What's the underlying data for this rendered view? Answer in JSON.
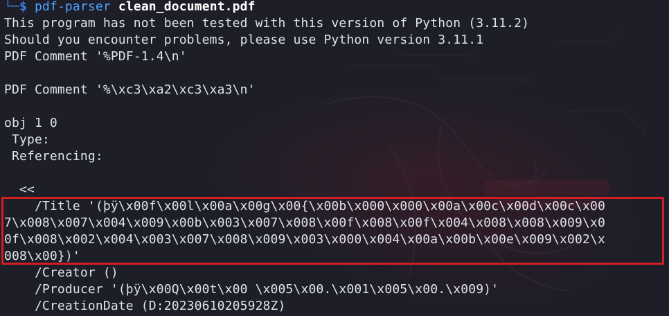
{
  "prompt": {
    "branch": "└─",
    "dollar": "$",
    "command": "pdf-parser",
    "argument": "clean_document.pdf"
  },
  "output": {
    "line1": "This program has not been tested with this version of Python (3.11.2)",
    "line2": "Should you encounter problems, please use Python version 3.11.1",
    "line3": "PDF Comment '%PDF-1.4\\n'",
    "line4": "PDF Comment '%\\xc3\\xa2\\xc3\\xa3\\n'",
    "line5": "obj 1 0",
    "line6": " Type: ",
    "line7": " Referencing: ",
    "line8": "  <<",
    "title_line1": "    /Title '(þÿ\\x00f\\x00l\\x00a\\x00g\\x00{\\x00b\\x000\\x000\\x00a\\x00c\\x00d\\x00c\\x00",
    "title_line2": "7\\x008\\x007\\x004\\x009\\x00b\\x003\\x007\\x008\\x00f\\x008\\x00f\\x004\\x008\\x008\\x009\\x0",
    "title_line3": "0f\\x008\\x002\\x004\\x003\\x007\\x008\\x009\\x003\\x000\\x004\\x00a\\x00b\\x00e\\x009\\x002\\x",
    "title_line4": "008\\x00})'",
    "creator": "    /Creator ()",
    "producer": "    /Producer '(þÿ\\x00Q\\x00t\\x00 \\x005\\x00.\\x001\\x005\\x00.\\x009)'",
    "creation_date": "    /CreationDate (D:20230610205928Z)"
  },
  "colors": {
    "background": "#1e1e28",
    "text": "#dfe3ea",
    "prompt_blue": "#3a7bd5",
    "command_blue": "#4fa3ff",
    "highlight_red": "#d11f24"
  }
}
